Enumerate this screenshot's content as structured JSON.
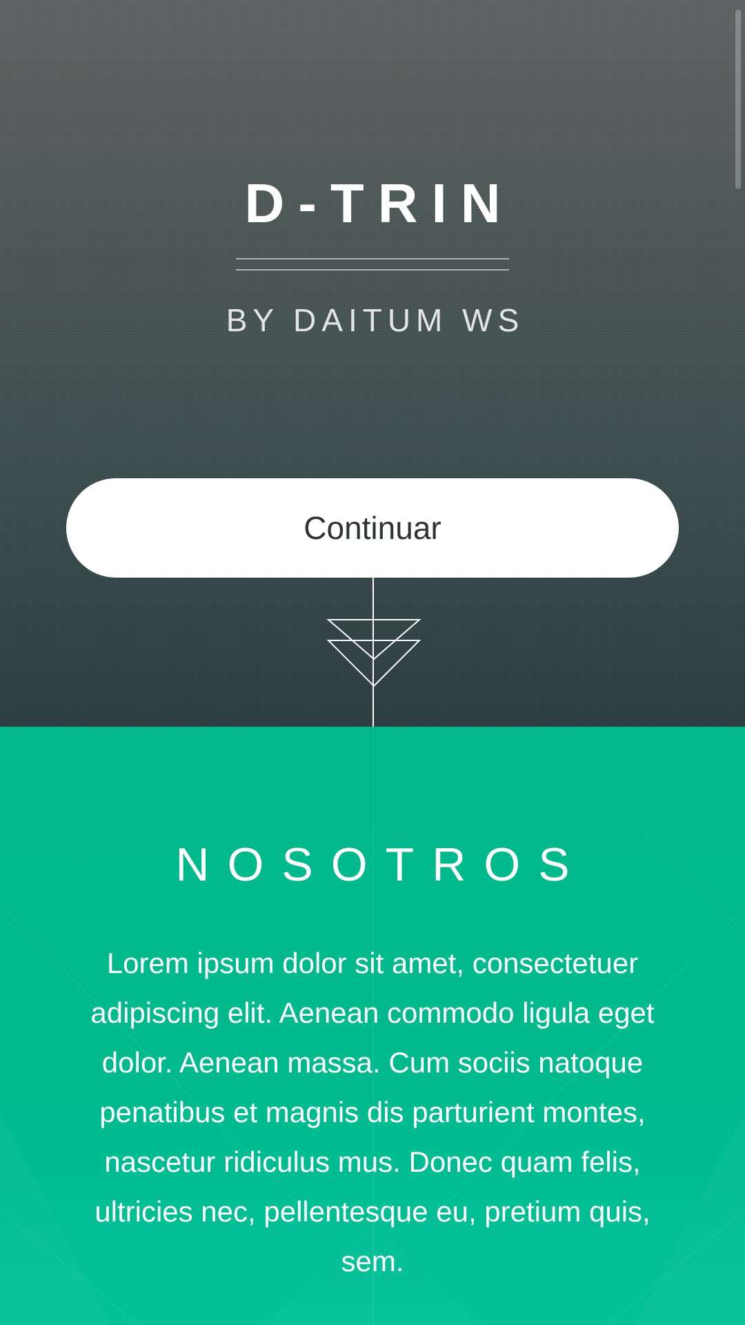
{
  "hero": {
    "title": "D-TRIN",
    "subtitle": "BY DAITUM WS",
    "continue_label": "Continuar"
  },
  "about": {
    "title": "NOSOTROS",
    "body": "Lorem ipsum dolor sit amet, consectetuer adipiscing elit. Aenean commodo ligula eget dolor. Aenean massa. Cum sociis natoque penatibus et magnis dis parturient montes, nascetur ridiculus mus. Donec quam felis, ultricies nec, pellentesque eu, pretium quis, sem."
  },
  "colors": {
    "hero_dark": "#2d3d3f",
    "hero_light": "#5d6362",
    "accent_green": "#00b88a",
    "button_bg": "#ffffff",
    "button_text": "#2f3333"
  },
  "icons": {
    "scroll_indicator": "double-chevron-down-icon"
  }
}
